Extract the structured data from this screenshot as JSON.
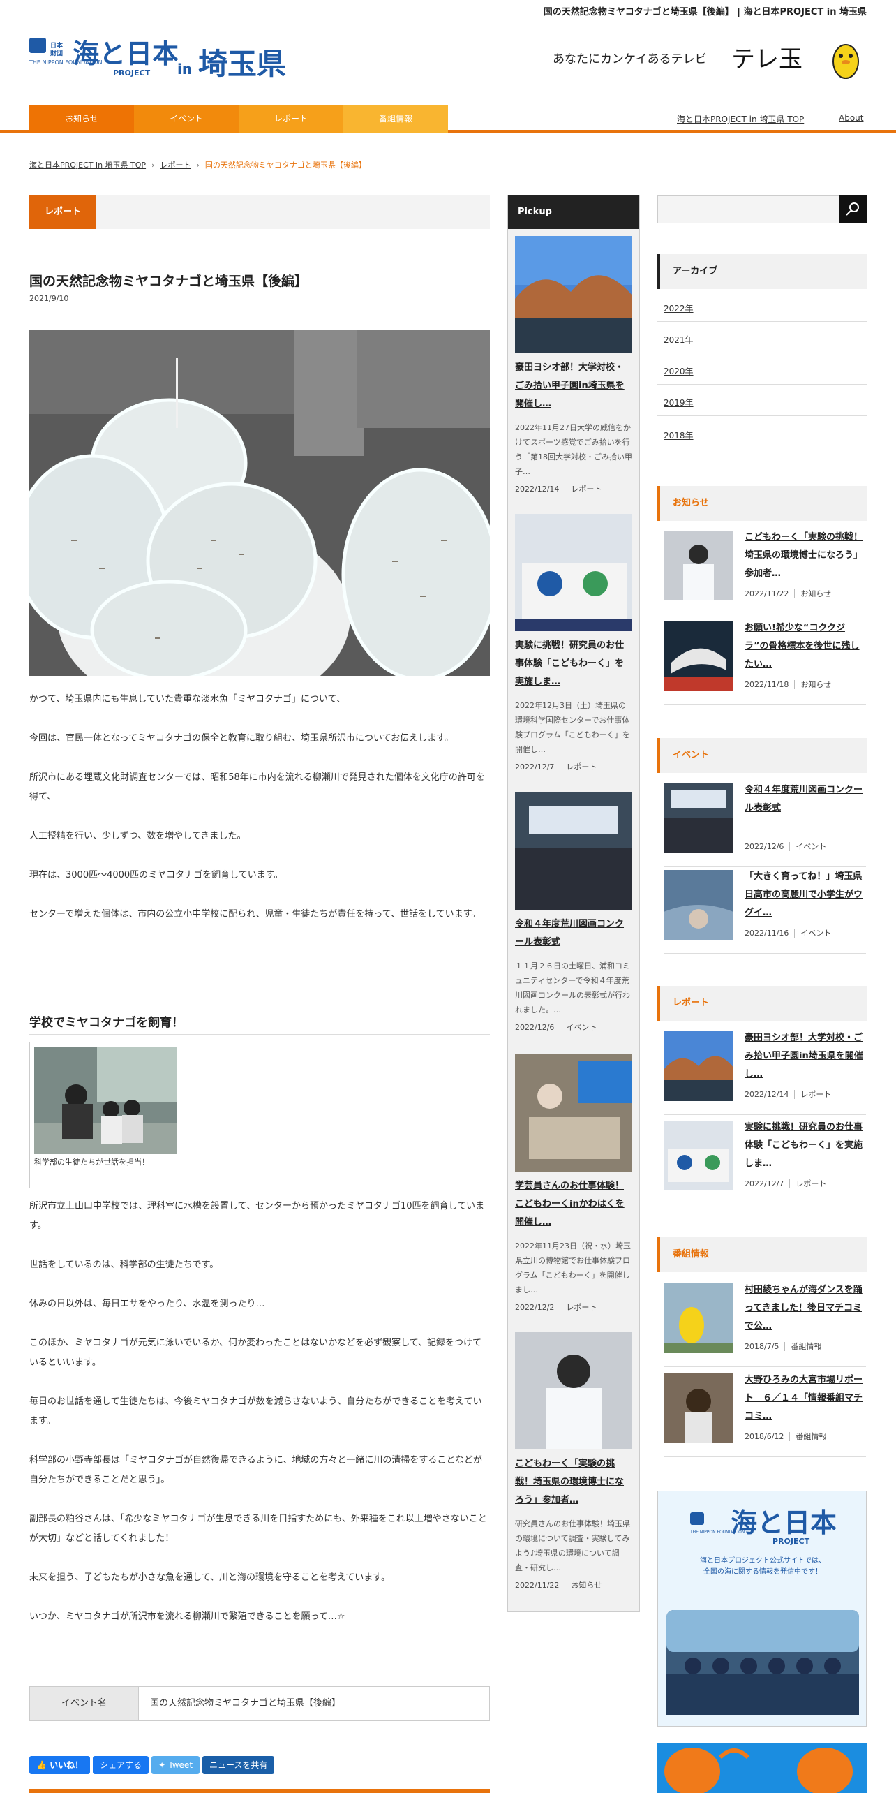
{
  "page_title": "国の天然記念物ミヤコタナゴと埼玉県【後編】 | 海と日本PROJECT in 埼玉県",
  "logo": {
    "nippon_foundation": "THE NIPPON FOUNDATION",
    "main": "海と日本",
    "project": "PROJECT",
    "in": "in",
    "pref": "埼玉県"
  },
  "tv": {
    "tagline": "あなたにカンケイあるテレビ",
    "name": "テレ玉"
  },
  "nav": {
    "tabs": [
      "お知らせ",
      "イベント",
      "レポート",
      "番組情報"
    ],
    "links": [
      "海と日本PROJECT in 埼玉県 TOP",
      "About"
    ]
  },
  "colors": {
    "tab1": "#ee7304",
    "tab2": "#f28a0c",
    "tab3": "#f6a01a",
    "tab4": "#f9b530",
    "accent": "#e8730c"
  },
  "breadcrumb": [
    "海と日本PROJECT in 埼玉県 TOP",
    "レポート",
    "国の天然記念物ミヤコタナゴと埼玉県【後編】"
  ],
  "main": {
    "category": "レポート",
    "title": "国の天然記念物ミヤコタナゴと埼玉県【後編】",
    "date": "2021/9/10",
    "paragraphs1": [
      "かつて、埼玉県内にも生息していた貴重な淡水魚「ミヤコタナゴ」について、",
      "今回は、官民一体となってミヤコタナゴの保全と教育に取り組む、埼玉県所沢市についてお伝えします。",
      "所沢市にある埋蔵文化財調査センターでは、昭和58年に市内を流れる柳瀬川で発見された個体を文化庁の許可を得て、",
      "人工授精を行い、少しずつ、数を増やしてきました。",
      "現在は、3000匹～4000匹のミヤコタナゴを飼育しています。",
      "センターで増えた個体は、市内の公立小中学校に配られ、児童・生徒たちが責任を持って、世話をしています。"
    ],
    "section_title": "学校でミヤコタナゴを飼育！",
    "figure_caption": "科学部の生徒たちが世話を担当！",
    "paragraphs2": [
      "所沢市立上山口中学校では、理科室に水槽を設置して、センターから預かったミヤコタナゴ10匹を飼育しています。",
      "世話をしているのは、科学部の生徒たちです。",
      "休みの日以外は、毎日エサをやったり、水温を測ったり…",
      "このほか、ミヤコタナゴが元気に泳いでいるか、何か変わったことはないかなどを必ず観察して、記録をつけているといいます。",
      "毎日のお世話を通して生徒たちは、今後ミヤコタナゴが数を減らさないよう、自分たちができることを考えています。",
      "科学部の小野寺部長は「ミヤコタナゴが自然復帰できるように、地域の方々と一緒に川の清掃をすることなどが自分たちができることだと思う」。",
      "副部長の粕谷さんは、「希少なミヤコタナゴが生息できる川を目指すためにも、外来種をこれ以上増やさないことが大切」などと話してくれました！",
      "未来を担う、子どもたちが小さな魚を通して、川と海の環境を守ることを考えています。",
      "いつか、ミヤコタナゴが所沢市を流れる柳瀬川で繁殖できることを願って…☆"
    ],
    "event_label": "イベント名",
    "event_value": "国の天然記念物ミヤコタナゴと埼玉県【後編】",
    "share": {
      "like": "いいね！",
      "share": "シェアする",
      "tweet": "Tweet",
      "news": "ニュースを共有"
    }
  },
  "pickup": {
    "heading": "Pickup",
    "items": [
      {
        "title": "豪田ヨシオ部！大学対校・ごみ拾い甲子園in埼玉県を開催し…",
        "excerpt": "2022年11月27日大学の威信をかけてスポーツ感覚でごみ拾いを行う「第18回大学対校・ごみ拾い甲子…",
        "date": "2022/12/14",
        "cat": "レポート"
      },
      {
        "title": "実験に挑戦！研究員のお仕事体験「こどもわーく」を実施しま…",
        "excerpt": "2022年12月3日（土）埼玉県の環境科学国際センターでお仕事体験プログラム「こどもわーく」を開催し…",
        "date": "2022/12/7",
        "cat": "レポート"
      },
      {
        "title": "令和４年度荒川図画コンクール表彰式",
        "excerpt": "１１月２６日の土曜日、浦和コミュニティセンターで令和４年度荒川図画コンクールの表彰式が行われました。…",
        "date": "2022/12/6",
        "cat": "イベント"
      },
      {
        "title": "学芸員さんのお仕事体験！こどもわーくinかわはくを開催し…",
        "excerpt": "2022年11月23日（祝・水）埼玉県立川の博物館でお仕事体験プログラム「こどもわーく」を開催しまし…",
        "date": "2022/12/2",
        "cat": "レポート"
      },
      {
        "title": "こどもわーく「実験の挑戦！埼玉県の環境博士になろう」参加者…",
        "excerpt": "研究員さんのお仕事体験！埼玉県の環境について調査・実験してみよう♪埼玉県の環境について調査・研究し…",
        "date": "2022/11/22",
        "cat": "お知らせ"
      }
    ]
  },
  "sidebar": {
    "archive_heading": "アーカイブ",
    "archive": [
      "2022年",
      "2021年",
      "2020年",
      "2019年",
      "2018年"
    ],
    "news": {
      "heading": "お知らせ",
      "items": [
        {
          "title": "こどもわーく「実験の挑戦！埼玉県の環境博士になろう」参加者…",
          "date": "2022/11/22",
          "cat": "お知らせ"
        },
        {
          "title": "お願い!希少な“コククジラ”の骨格標本を後世に残したい…",
          "date": "2022/11/18",
          "cat": "お知らせ"
        }
      ]
    },
    "events": {
      "heading": "イベント",
      "items": [
        {
          "title": "令和４年度荒川図画コンクール表彰式",
          "date": "2022/12/6",
          "cat": "イベント"
        },
        {
          "title": "「大きく育ってね！」埼玉県日高市の高麗川で小学生がウグイ…",
          "date": "2022/11/16",
          "cat": "イベント"
        }
      ]
    },
    "reports": {
      "heading": "レポート",
      "items": [
        {
          "title": "豪田ヨシオ部！大学対校・ごみ拾い甲子園in埼玉県を開催し…",
          "date": "2022/12/14",
          "cat": "レポート"
        },
        {
          "title": "実験に挑戦！研究員のお仕事体験「こどもわーく」を実施しま…",
          "date": "2022/12/7",
          "cat": "レポート"
        }
      ]
    },
    "program": {
      "heading": "番組情報",
      "items": [
        {
          "title": "村田綾ちゃんが海ダンスを踊ってきました！後日マチコミで公…",
          "date": "2018/7/5",
          "cat": "番組情報"
        },
        {
          "title": "大野ひろみの大宮市場リポート　６／１４「情報番組マチコミ…",
          "date": "2018/6/12",
          "cat": "番組情報"
        }
      ]
    },
    "banner": {
      "main": "海と日本",
      "project": "PROJECT",
      "nf": "THE NIPPON FOUNDATION",
      "line1": "海と日本プロジェクト公式サイトでは、",
      "line2": "全国の海に関する情報を発信中です！"
    }
  }
}
